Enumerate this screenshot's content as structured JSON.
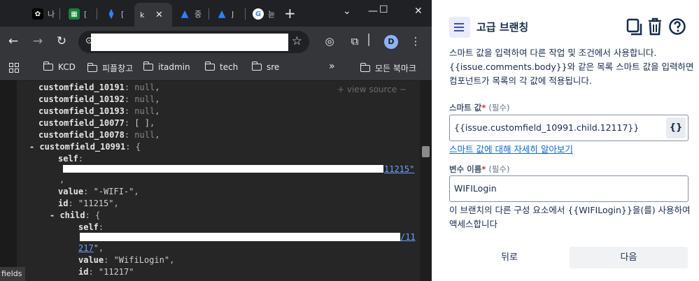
{
  "browser": {
    "tabs": [
      {
        "title": "나",
        "icon": "notion-icon",
        "color": "#000000"
      },
      {
        "title": "[",
        "icon": "sheets-icon",
        "color": "#188038"
      },
      {
        "title": "[",
        "icon": "jira-icon",
        "color": "#2684ff"
      },
      {
        "title": "k",
        "icon": "page-icon",
        "active": true
      },
      {
        "title": "중",
        "icon": "atlassian-icon",
        "color": "#2684ff"
      },
      {
        "title": "J",
        "icon": "atlassian-icon",
        "color": "#2684ff"
      },
      {
        "title": "늗",
        "icon": "google-icon",
        "color": "#4285f4"
      }
    ],
    "avatar_letter": "D",
    "bookmarks": [
      "KCD",
      "피플창고",
      "itadmin",
      "tech",
      "sre"
    ],
    "other_bookmarks": "모든 북마크",
    "overflow": "»",
    "json": {
      "view_source": "+ view source  −",
      "rows": [
        {
          "key": "customfield_10191",
          "val": "null"
        },
        {
          "key": "customfield_10192",
          "val": "null"
        },
        {
          "key": "customfield_10193",
          "val": "null"
        },
        {
          "key": "customfield_10077",
          "val": "[ ]"
        },
        {
          "key": "customfield_10078",
          "val": "null"
        }
      ],
      "obj_key": "customfield_10991",
      "self_key": "self",
      "self_link_tail": "11215\"",
      "value_key": "value",
      "value_val": "\"-WIFI-\"",
      "id_key": "id",
      "id_val": "\"11215\"",
      "child_key": "child",
      "child_self_tail_1": "/11",
      "child_self_tail_2": "217",
      "child_value_val": "\"WifiLogin\"",
      "child_id_val": "\"11217\""
    },
    "status_text": "fields"
  },
  "panel": {
    "title": "고급 브랜칭",
    "description": "스마트 값을 입력하여 다른 작업 및 조건에서 사용합니다. {{issue.comments.body}}와 같은 목록 스마트 값을 입력하면 컴포넌트가 목록의 각 값에 적용됩니다.",
    "smart_value_label": "스마트 값",
    "required_mark": "*",
    "required_text": "(필수)",
    "smart_value": "{{issue.customfield_10991.child.12117}}",
    "brace_button": "{}",
    "learn_more": "스마트 값에 대해 자세히 알아보기",
    "var_name_label": "변수 이름",
    "var_name_value": "WIFILogin",
    "help_text": "이 브랜치의 다른 구성 요소에서 {{WIFILogin}}을(를) 사용하여 액세스합니다",
    "back_button": "뒤로",
    "next_button": "다음"
  }
}
